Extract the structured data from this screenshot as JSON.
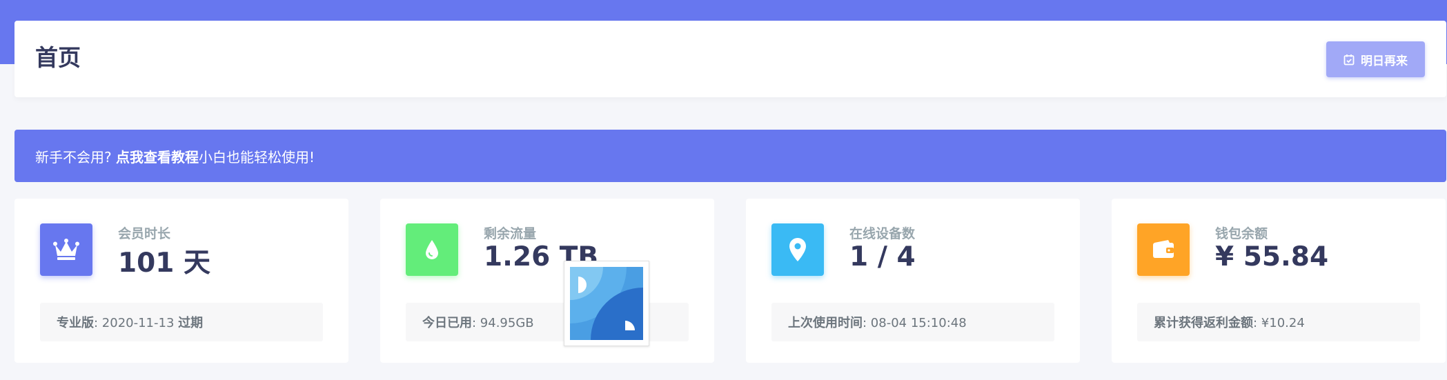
{
  "header": {
    "title": "首页",
    "checkin_label": "明日再来",
    "checkin_icon": "calendar-check-icon"
  },
  "notice": {
    "prefix": "新手不会用?",
    "link": "点我查看教程",
    "suffix": "小白也能轻松使用!"
  },
  "stats": [
    {
      "icon": "crown-icon",
      "color": "#6777ef",
      "label": "会员时长",
      "value": "101 天",
      "footer_label": "专业版",
      "footer_value": "2020-11-13",
      "footer_suffix": "过期"
    },
    {
      "icon": "droplet-icon",
      "color": "#63ed7a",
      "label": "剩余流量",
      "value": "1.26 TB",
      "footer_label": "今日已用",
      "footer_value": "94.95GB"
    },
    {
      "icon": "map-marker-icon",
      "color": "#3abaf4",
      "label": "在线设备数",
      "value": "1 / 4",
      "footer_label": "上次使用时间",
      "footer_value": "08-04 15:10:48"
    },
    {
      "icon": "wallet-icon",
      "color": "#ffa426",
      "label": "钱包余额",
      "value": "¥ 55.84",
      "footer_label": "累计获得返利金额",
      "footer_value": "¥10.24"
    }
  ],
  "colors": {
    "primary": "#6777ef",
    "background": "#f5f6fa"
  }
}
